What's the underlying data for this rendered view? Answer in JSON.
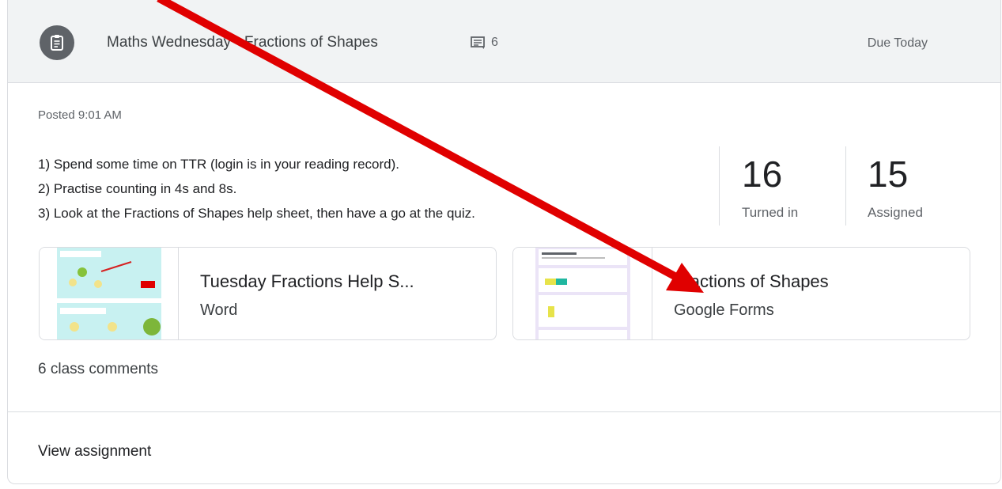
{
  "assignment": {
    "title": "Maths Wednesday - Fractions of Shapes",
    "comment_count": "6",
    "due": "Due Today",
    "posted": "Posted 9:01 AM",
    "description": [
      "1) Spend some time on TTR (login is in your reading record).",
      "2) Practise counting in 4s and 8s.",
      "3) Look at the Fractions of Shapes help sheet, then have a go at the quiz."
    ],
    "stats": [
      {
        "value": "16",
        "label": "Turned in"
      },
      {
        "value": "15",
        "label": "Assigned"
      }
    ],
    "attachments": [
      {
        "title": "Tuesday Fractions Help S...",
        "type": "Word"
      },
      {
        "title": "Fractions of Shapes",
        "type": "Google Forms"
      }
    ],
    "class_comments": "6 class comments",
    "view_link": "View assignment"
  },
  "colors": {
    "header_bg": "#f1f3f4",
    "icon_bg": "#5f6368",
    "annotation_arrow": "#e00000"
  },
  "icons": [
    "assignment-icon",
    "comment-icon"
  ]
}
